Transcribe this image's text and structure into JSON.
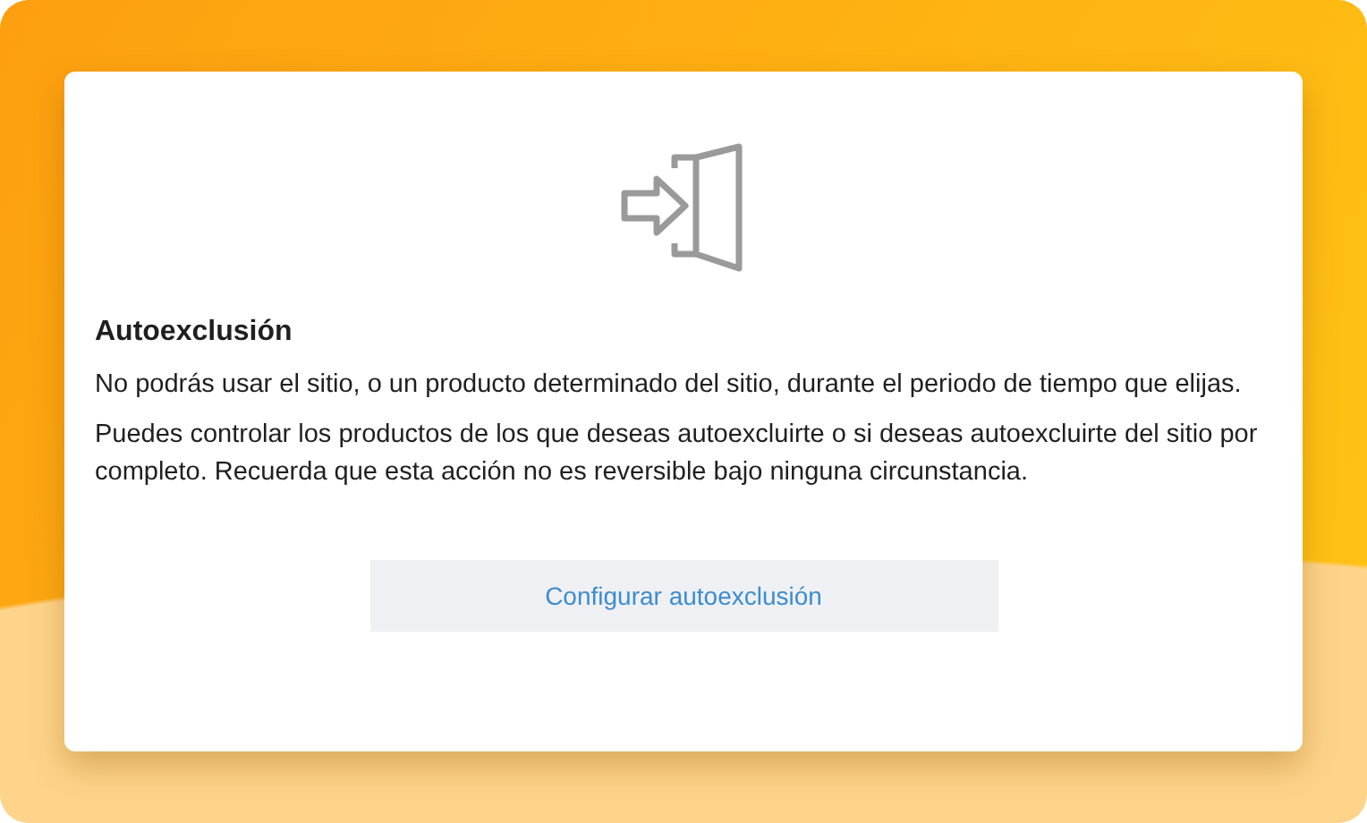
{
  "dialog": {
    "title": "Autoexclusión",
    "paragraphs": [
      "No podrás usar el sitio, o un producto determinado del sitio, durante el periodo de tiempo que elijas.",
      "Puedes controlar los productos de los que deseas autoexcluirte o si deseas autoexcluirte del sitio por completo. Recuerda que esta acción no es reversible bajo ninguna circunstancia."
    ],
    "button": "Configurar autoexclusión"
  }
}
